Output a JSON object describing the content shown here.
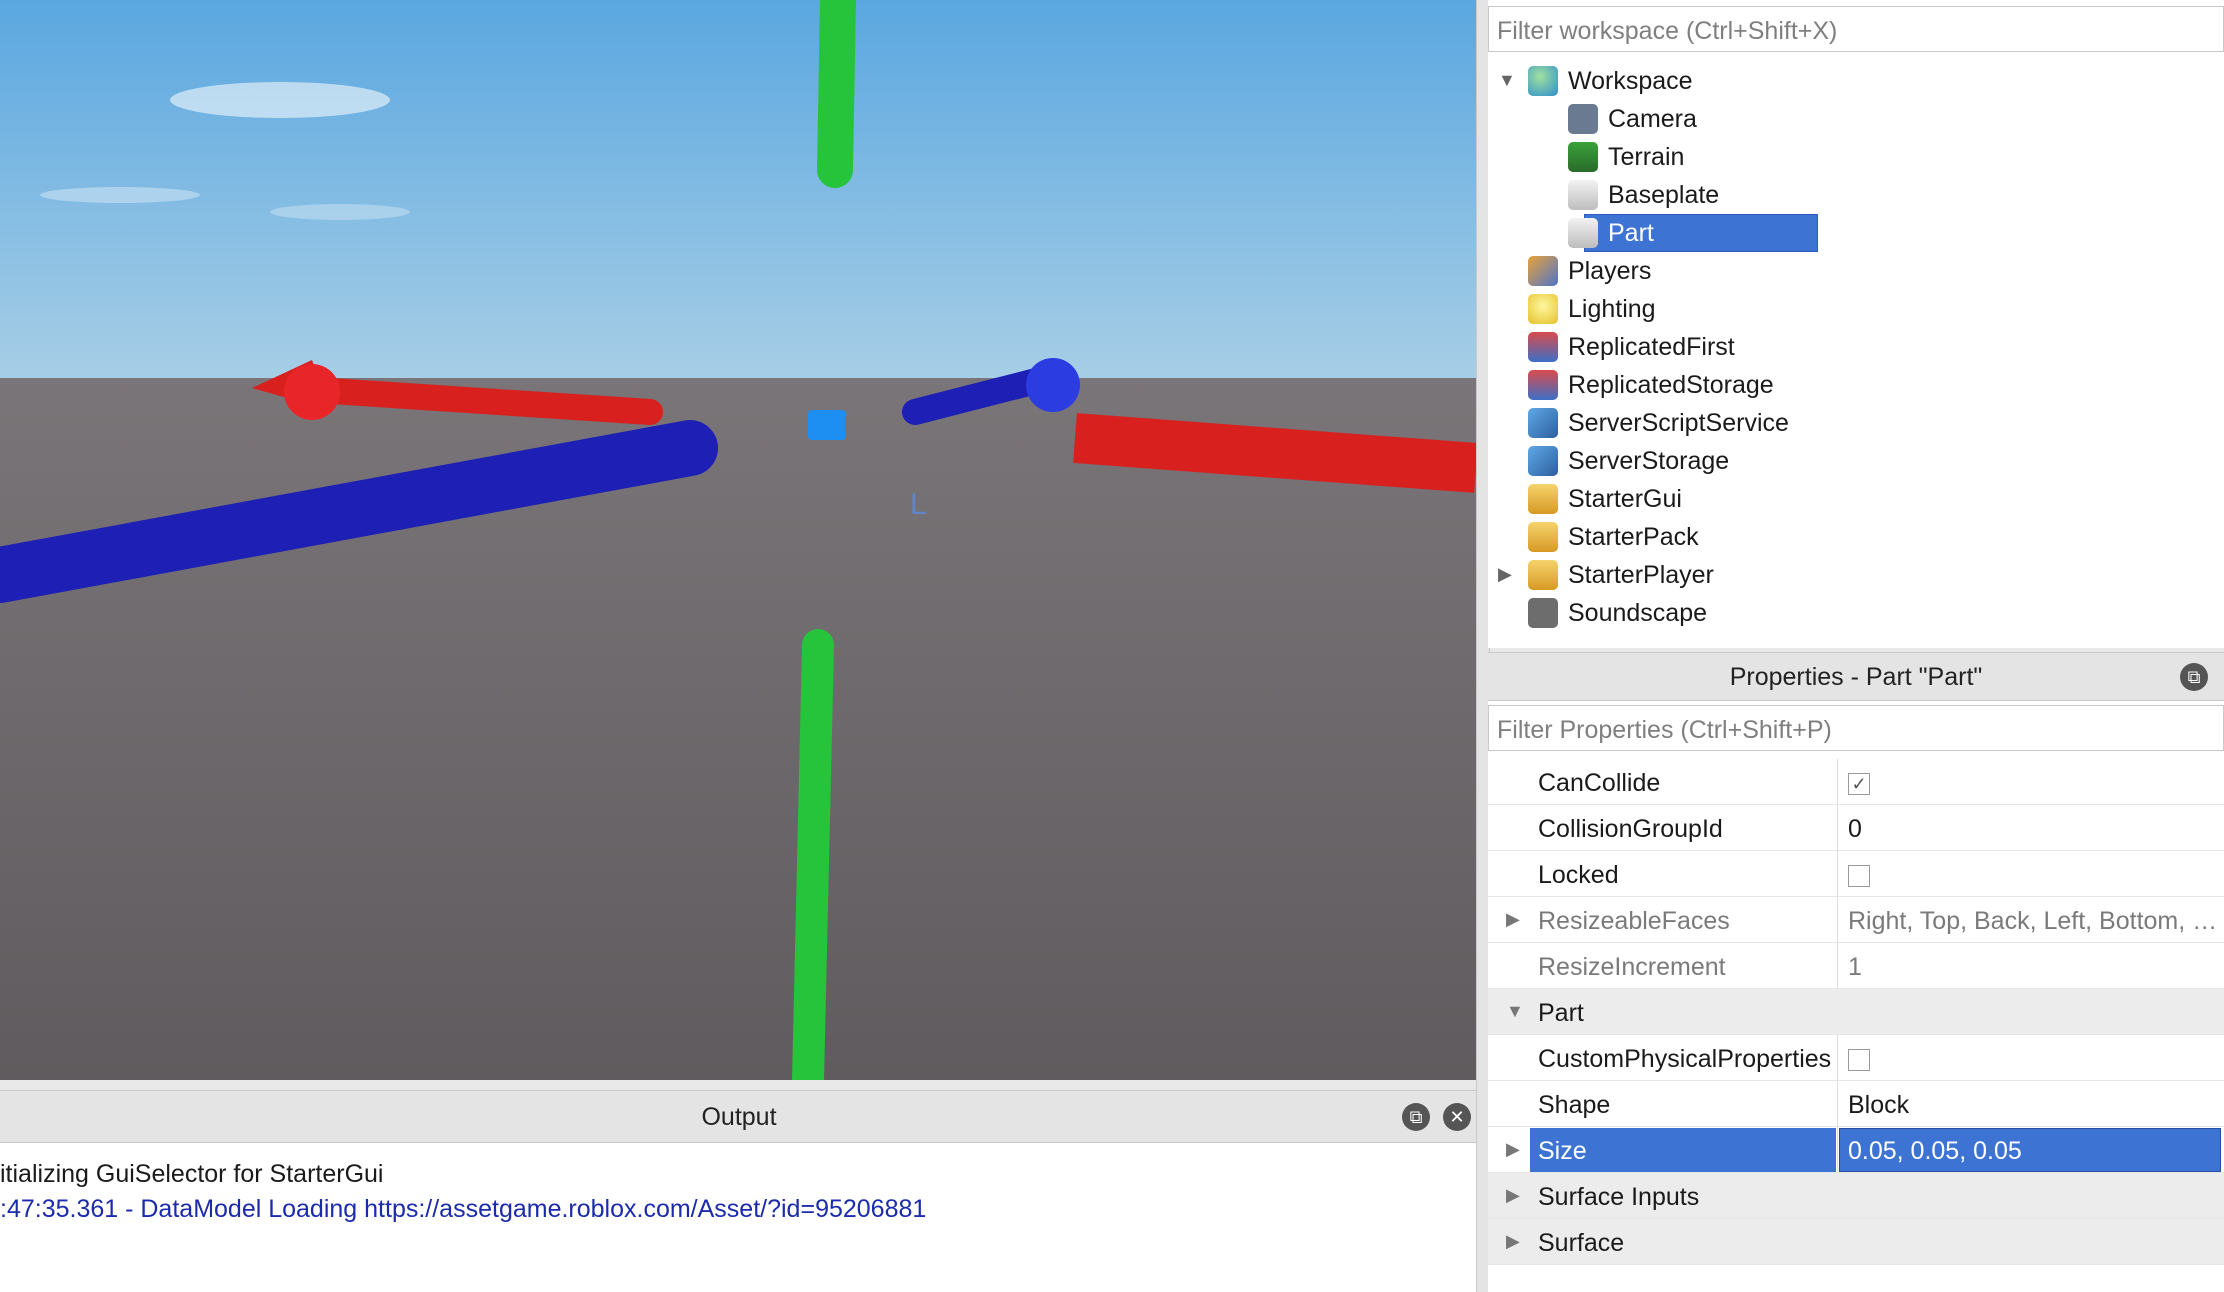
{
  "viewport": {
    "label": "L"
  },
  "explorer": {
    "filter_placeholder": "Filter workspace (Ctrl+Shift+X)",
    "items": [
      {
        "label": "Workspace",
        "icon": "globe-icon",
        "expanded": true
      },
      {
        "label": "Camera",
        "icon": "camera-icon"
      },
      {
        "label": "Terrain",
        "icon": "terrain-icon"
      },
      {
        "label": "Baseplate",
        "icon": "part-block-icon"
      },
      {
        "label": "Part",
        "icon": "part-block-icon",
        "selected": true
      },
      {
        "label": "Players",
        "icon": "players-icon"
      },
      {
        "label": "Lighting",
        "icon": "lightbulb-icon"
      },
      {
        "label": "ReplicatedFirst",
        "icon": "replicated-first-icon"
      },
      {
        "label": "ReplicatedStorage",
        "icon": "replicated-storage-icon"
      },
      {
        "label": "ServerScriptService",
        "icon": "server-script-service-icon"
      },
      {
        "label": "ServerStorage",
        "icon": "server-storage-icon"
      },
      {
        "label": "StarterGui",
        "icon": "starter-gui-icon"
      },
      {
        "label": "StarterPack",
        "icon": "starter-pack-icon"
      },
      {
        "label": "StarterPlayer",
        "icon": "starter-player-icon",
        "collapsed": true
      },
      {
        "label": "Soundscape",
        "icon": "speaker-icon"
      }
    ]
  },
  "properties": {
    "title": "Properties - Part \"Part\"",
    "filter_placeholder": "Filter Properties (Ctrl+Shift+P)",
    "rows": [
      {
        "name": "CanCollide",
        "checkbox": true,
        "checked": true
      },
      {
        "name": "CollisionGroupId",
        "value": "0"
      },
      {
        "name": "Locked",
        "checkbox": true,
        "checked": false
      },
      {
        "name": "ResizeableFaces",
        "value": "Right, Top, Back, Left, Bottom, …",
        "dim": true,
        "arrow": "collapsed"
      },
      {
        "name": "ResizeIncrement",
        "value": "1",
        "dim": true
      },
      {
        "name": "Part",
        "category": true,
        "arrow": "expanded"
      },
      {
        "name": "CustomPhysicalProperties",
        "checkbox": true,
        "checked": false
      },
      {
        "name": "Shape",
        "value": "Block"
      },
      {
        "name": "Size",
        "value": "0.05, 0.05, 0.05",
        "selected": true,
        "arrow": "collapsed"
      },
      {
        "name": "Surface Inputs",
        "category": true,
        "arrow": "collapsed"
      },
      {
        "name": "Surface",
        "category": true,
        "arrow": "collapsed"
      }
    ]
  },
  "output": {
    "title": "Output",
    "lines": [
      {
        "text": "itializing GuiSelector for StarterGui",
        "color": "#1a1a1a"
      },
      {
        "text": ":47:35.361 - DataModel Loading https://assetgame.roblox.com/Asset/?id=95206881",
        "color": "#1c2bab"
      }
    ]
  },
  "colors": {
    "selection": "#3d73d2",
    "sky": "#6fb2e4",
    "ground": "#6e6a6d",
    "axis_red": "#d8201f",
    "axis_blue": "#1d1fb5",
    "axis_green": "#26c43a"
  }
}
